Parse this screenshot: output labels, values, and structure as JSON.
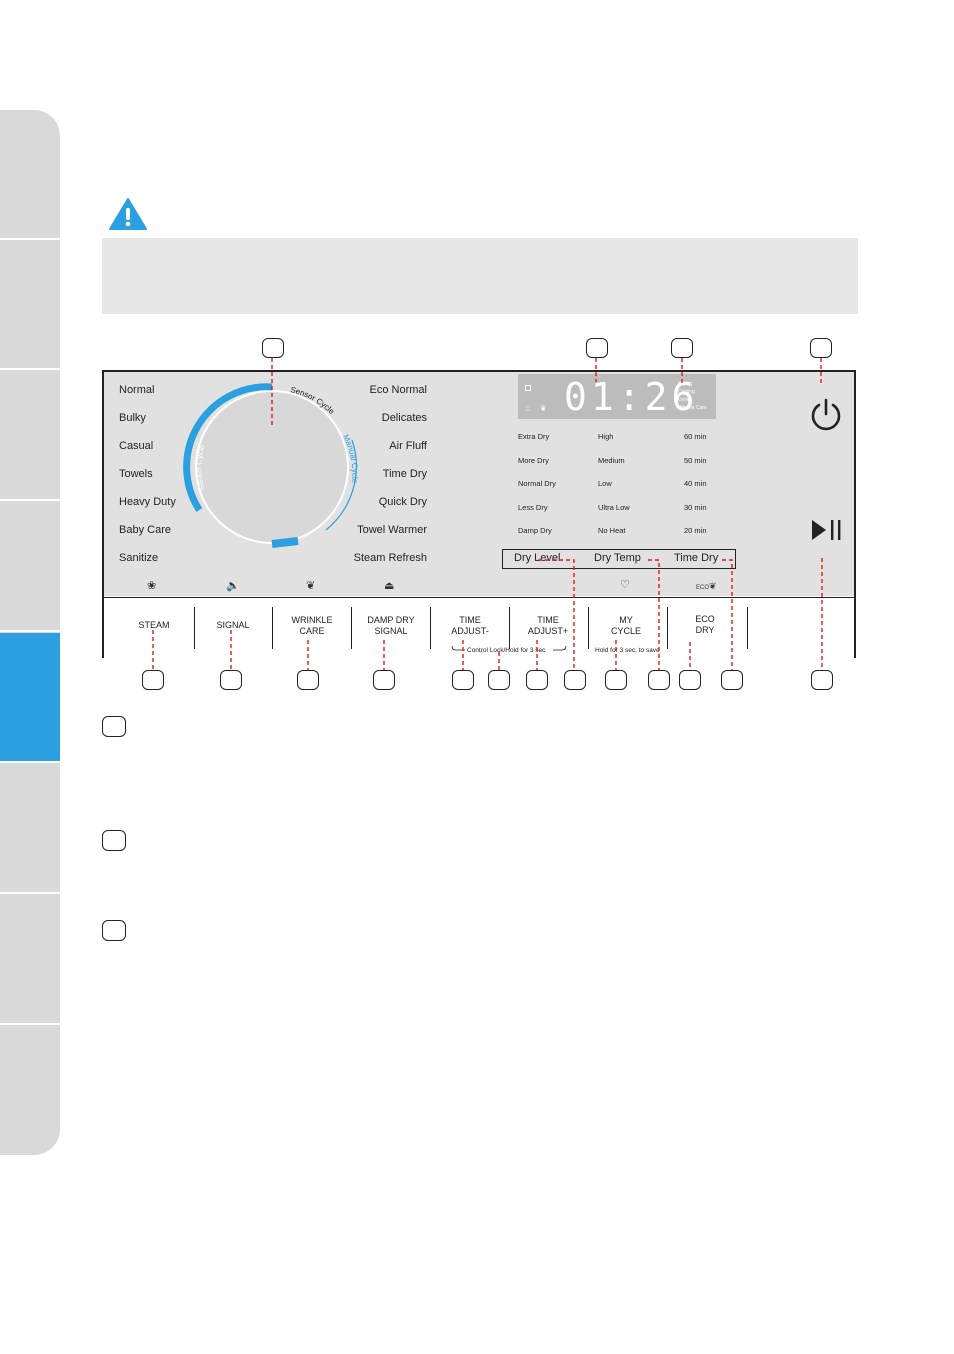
{
  "side_tabs": [
    "",
    "",
    "",
    "",
    "",
    "",
    "",
    ""
  ],
  "warning": {
    "icon": "warning-triangle-icon",
    "text": ""
  },
  "panel": {
    "programs_left": [
      "Normal",
      "Bulky",
      "Casual",
      "Towels",
      "Heavy Duty",
      "Baby Care",
      "Sanitize"
    ],
    "programs_right": [
      "Eco Normal",
      "Delicates",
      "Air Fluff",
      "Time Dry",
      "Quick Dry",
      "Towel Warmer",
      "Steam Refresh"
    ],
    "dial_arcs": [
      "Steam Cycle",
      "Sensor Cycle",
      "Manual Cycle"
    ],
    "display": {
      "time": "01:26",
      "status": [
        "Drying",
        "Cooling",
        "Done",
        "Wrinkle Care"
      ]
    },
    "dry_level": [
      "Extra Dry",
      "More Dry",
      "Normal Dry",
      "Less Dry",
      "Damp Dry"
    ],
    "dry_temp": [
      "High",
      "Medium",
      "Low",
      "Ultra Low",
      "No Heat"
    ],
    "time_dry": [
      "60 min",
      "50 min",
      "40 min",
      "30 min",
      "20 min"
    ],
    "option_labels": {
      "dry_level": "Dry Level",
      "dry_temp": "Dry Temp",
      "time_dry": "Time Dry"
    },
    "eco_icon_text": "ECO",
    "buttons": [
      {
        "l1": "STEAM",
        "l2": ""
      },
      {
        "l1": "SIGNAL",
        "l2": ""
      },
      {
        "l1": "WRINKLE",
        "l2": "CARE"
      },
      {
        "l1": "DAMP DRY",
        "l2": "SIGNAL"
      },
      {
        "l1": "TIME",
        "l2": "ADJUST-"
      },
      {
        "l1": "TIME",
        "l2": "ADJUST+"
      },
      {
        "l1": "MY",
        "l2": "CYCLE"
      },
      {
        "l1": "ECO",
        "l2": "DRY"
      }
    ],
    "control_lock_note": "Control Lock/Hold for 3 sec",
    "my_cycle_note": "Hold for 3 sec. to save"
  },
  "colors": {
    "accent": "#2b9fe0",
    "callout_line": "#e01b1b",
    "panel_bg": "#e1e1e1"
  }
}
